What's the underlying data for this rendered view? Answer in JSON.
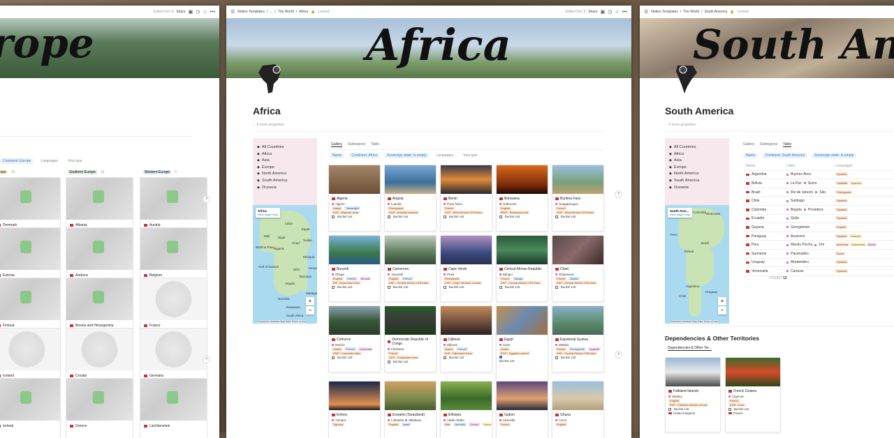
{
  "europe": {
    "edited": "Edited Dec 9",
    "share": "Share",
    "cover_title": "rope",
    "filter_continent": "Continent: Europe",
    "filter_languages": "Languages",
    "filter_visa": "Visa type",
    "groups": [
      {
        "name": "Southern Europe",
        "count": "10"
      },
      {
        "name": "Southern Europe",
        "count": "16"
      },
      {
        "name": "Western Europe",
        "count": "9"
      }
    ],
    "cards": [
      [
        "Denmark",
        "Albania",
        "Austria"
      ],
      [
        "Estonia",
        "Andorra",
        "Belgium"
      ],
      [
        "Finland",
        "Bosnia and Herzegovina",
        "France"
      ],
      [
        "Iceland",
        "Croatia",
        "Germany"
      ],
      [
        "Ireland",
        "Greece",
        "Liechtenstein"
      ]
    ]
  },
  "africa": {
    "breadcrumb": [
      "Notion Templates",
      "/",
      "...",
      "/",
      "The World",
      "/",
      "Africa"
    ],
    "locked": "Locked",
    "edited": "Edited Dec 9",
    "share": "Share",
    "cover_title": "Africa",
    "page_title": "Africa",
    "props": "6 more properties",
    "tabs": [
      "Gallery",
      "Subregions",
      "Table"
    ],
    "filters": [
      "Name",
      "Continent: Africa",
      "Sovereign state: Is empty",
      "Languages",
      "Visa type"
    ],
    "nav": [
      "All Countries",
      "Africa",
      "Asia",
      "Europe",
      "North America",
      "South America",
      "Oceania"
    ],
    "map": {
      "popup_title": "Africa",
      "popup_link": "View larger map",
      "labels": [
        "Libya",
        "Egypt",
        "Mali",
        "Niger",
        "Chad",
        "Sudan",
        "Nigeria",
        "Ethiopia",
        "DRC",
        "Angola",
        "Tanzania",
        "Namibia",
        "Botswana",
        "Madagascar",
        "South Africa",
        "Burkina Faso",
        "Gulf of Guinea",
        "Kenya"
      ],
      "footer": "Keyboard shortcuts  Map Data  Terms of Use"
    },
    "cards": [
      {
        "name": "Algeria",
        "city": "Algiers",
        "langs": [
          "Arabic",
          "Tamazight"
        ],
        "currency": "DZD - Algerian dinar",
        "bucket": "Bucket List",
        "checked": false,
        "img": "linear-gradient(180deg,#a38568,#6c4e35)"
      },
      {
        "name": "Angola",
        "city": "Luanda",
        "langs": [
          "Portuguese"
        ],
        "currency": "AOA - Angolan kwanza",
        "bucket": "Bucket List",
        "checked": false,
        "img": "linear-gradient(180deg,#7aa7d4,#3a6f9a 60%,#c9b08a)"
      },
      {
        "name": "Benin",
        "city": "Porto Novo",
        "langs": [
          "French"
        ],
        "currency": "XOF - West African CFA franc",
        "bucket": "Bucket List",
        "checked": false,
        "img": "linear-gradient(180deg,#3a3a4a,#e08a3a 50%,#2a2a30)"
      },
      {
        "name": "Botswana",
        "city": "Gaborone",
        "langs": [
          "English"
        ],
        "currency": "BWP - Botswana pula",
        "bucket": "Bucket List",
        "checked": false,
        "img": "linear-gradient(180deg,#d86a1a,#7a2a0a 70%,#1a0a05)"
      },
      {
        "name": "Burkina Faso",
        "city": "Ouagadougou",
        "langs": [
          "French"
        ],
        "currency": "XOF - West African CFA franc",
        "bucket": "Bucket List",
        "checked": false,
        "img": "linear-gradient(180deg,#9ac0e0,#7aa07a 60%,#c0a070)"
      },
      {
        "name": "Burundi",
        "city": "Gitega",
        "langs": [
          "English",
          "French",
          "Kirundi"
        ],
        "currency": "BIF - Burundian franc",
        "bucket": "Bucket List",
        "checked": false,
        "img": "linear-gradient(180deg,#7ab0d8,#3a7a4a 60%,#2a5a8a)"
      },
      {
        "name": "Cameroon",
        "city": "Yaoundé",
        "langs": [
          "English",
          "French"
        ],
        "currency": "XAF - Central African CFA franc",
        "bucket": "Bucket List",
        "checked": false,
        "img": "linear-gradient(180deg,#c0c8c0,#5a7a5a 60%,#3a4a3a)"
      },
      {
        "name": "Cape Verde",
        "city": "Praia",
        "langs": [
          "Portuguese"
        ],
        "currency": "CVE - Cape Verdean escudo",
        "bucket": "Bucket List",
        "checked": false,
        "img": "linear-gradient(180deg,#b090c0,#3a4a80 60%,#2a3050)"
      },
      {
        "name": "Central African Republic",
        "city": "Bangui",
        "langs": [
          "French",
          "Sango"
        ],
        "currency": "XAF - Central African CFA franc",
        "bucket": "Bucket List",
        "checked": false,
        "img": "linear-gradient(180deg,#2a5a3a,#4a8a5a 50%,#1a3a2a)"
      },
      {
        "name": "Chad",
        "city": "N'Djamena",
        "langs": [
          "French",
          "Arabic"
        ],
        "currency": "XAF - Central African CFA franc",
        "bucket": "Bucket List",
        "checked": false,
        "img": "linear-gradient(135deg,#5a4a4a,#8a6a6a 50%,#3a2a2a)"
      },
      {
        "name": "Comoros",
        "city": "Moroni",
        "langs": [
          "Arabic",
          "French",
          "Comorian"
        ],
        "currency": "KMF - Comorian franc",
        "bucket": "Bucket List",
        "checked": false,
        "img": "linear-gradient(180deg,#8aa0b0,#3a5a3a 50%,#2a3a2a)"
      },
      {
        "name": "Democratic Republic of Congo",
        "city": "Kinshasa",
        "langs": [
          "French"
        ],
        "currency": "CDF - Congolese franc",
        "bucket": "Bucket List",
        "checked": false,
        "img": "linear-gradient(180deg,#2a5a2a,#3a3a3a 50%,#1a3a1a)"
      },
      {
        "name": "Djibouti",
        "city": "Djibouti",
        "langs": [
          "Arabic",
          "French"
        ],
        "currency": "DJF - Djiboutian franc",
        "bucket": "Bucket List",
        "checked": false,
        "img": "linear-gradient(180deg,#c08a5a,#6a4a3a 60%,#2a2020)"
      },
      {
        "name": "Egypt",
        "city": "Cairo",
        "langs": [
          "Arabic"
        ],
        "currency": "EGP - Egyptian pound",
        "bucket": "Bucket List",
        "checked": true,
        "img": "linear-gradient(135deg,#c09050,#6a8ab0 50%,#a07040)"
      },
      {
        "name": "Equatorial Guinea",
        "city": "Malabo",
        "langs": [
          "French",
          "Portuguese",
          "Spanish"
        ],
        "currency": "XAF - Central African CFA franc",
        "bucket": "Bucket List",
        "checked": false,
        "img": "linear-gradient(180deg,#8ab0c8,#5a8a6a 60%,#4a6a5a)"
      },
      {
        "name": "Eritrea",
        "city": "Asmara",
        "langs": [
          "Tigrinya"
        ],
        "currency": "",
        "bucket": "",
        "checked": false,
        "img": "linear-gradient(180deg,#1a2a4a,#e09050 80%,#1a1a20)"
      },
      {
        "name": "Eswatini (Swaziland)",
        "city": "Lobamba",
        "city2": "Mbabane",
        "langs": [
          "English",
          "swati"
        ],
        "currency": "",
        "bucket": "",
        "checked": false,
        "img": "linear-gradient(180deg,#d0a060,#7a8a4a 60%,#4a5a2a)"
      },
      {
        "name": "Ethiopia",
        "city": "Addis Ababa",
        "langs": [
          "Afar",
          "Amharic",
          "Oromo",
          "Soma"
        ],
        "currency": "",
        "bucket": "",
        "checked": false,
        "img": "linear-gradient(180deg,#8ab050,#3a6a2a 60%,#5a8a3a)"
      },
      {
        "name": "Gabon",
        "city": "Libreville",
        "langs": [
          "French"
        ],
        "currency": "",
        "bucket": "",
        "checked": false,
        "img": "linear-gradient(180deg,#5a4a80,#e0a070 60%,#2a2a3a)"
      },
      {
        "name": "Ghana",
        "city": "Accra",
        "langs": [
          "English"
        ],
        "currency": "",
        "bucket": "",
        "checked": false,
        "img": "linear-gradient(180deg,#9ac0e0,#d8c8a8 60%,#b0a080)"
      }
    ]
  },
  "southamerica": {
    "breadcrumb": [
      "Notion Templates",
      "/",
      "The World",
      "/",
      "South America"
    ],
    "locked": "Locked",
    "cover_title": "South Am",
    "page_title": "South America",
    "props": "6 more properties",
    "tabs": [
      "Gallery",
      "Subregions",
      "Table"
    ],
    "filters": [
      "Name",
      "Continent: South America",
      "Sovereign state: Is empty"
    ],
    "nav": [
      "All Countries",
      "Africa",
      "Asia",
      "Europe",
      "North America",
      "South America",
      "Oceania"
    ],
    "map": {
      "popup_title": "South Ame...",
      "popup_link": "View larger map",
      "labels": [
        "Colombia",
        "Venezuela",
        "Peru",
        "Brazil",
        "Bolivia",
        "Argentina",
        "Chile",
        "Uruguay"
      ],
      "footer": "Keyboard shortcuts  Map Data  Terms of Use"
    },
    "table_headers": [
      "Name",
      "Cities",
      "Languages"
    ],
    "rows": [
      {
        "name": "Argentina",
        "city": "Buenos Aires",
        "langs": [
          "Spanish"
        ]
      },
      {
        "name": "Bolivia",
        "city": "La Paz",
        "city2": "Sucre",
        "langs": [
          "Castilian",
          "Spanish"
        ]
      },
      {
        "name": "Brazil",
        "city": "Rio de Janeiro",
        "city2": "São",
        "langs": [
          "Portuguese"
        ]
      },
      {
        "name": "Chile",
        "city": "Santiago",
        "langs": [
          "Spanish"
        ]
      },
      {
        "name": "Colombia",
        "city": "Bogota",
        "city2": "Providenc",
        "langs": [
          "Spanish"
        ]
      },
      {
        "name": "Ecuador",
        "city": "Quito",
        "langs": [
          "Spanish"
        ]
      },
      {
        "name": "Guyana",
        "city": "Georgetown",
        "langs": [
          "English"
        ]
      },
      {
        "name": "Paraguay",
        "city": "Asuncion",
        "langs": [
          "Spanish",
          "Guarani"
        ]
      },
      {
        "name": "Peru",
        "city": "Machu Picchu",
        "city2": "Lim",
        "langs": [
          "Quechua",
          "Achaninka",
          "Ayma"
        ]
      },
      {
        "name": "Suriname",
        "city": "Paramaribo",
        "langs": [
          "Dutch"
        ]
      },
      {
        "name": "Uruguay",
        "city": "Montevideo",
        "langs": [
          "Spanish"
        ]
      },
      {
        "name": "Venezuela",
        "city": "Caracas",
        "langs": [
          "Spanish"
        ]
      }
    ],
    "count_label": "COUNT",
    "count": "12",
    "dep_title": "Dependencies & Other Territories",
    "dep_tab": "Dependencies & Other Ter...",
    "dep_cards": [
      {
        "name": "Falkland Islands",
        "city": "Stanley",
        "langs": [
          "English"
        ],
        "currency": "FKP - Falkland Islands' pound",
        "bucket": "Bucket List",
        "sov": "United Kingdom"
      },
      {
        "name": "French Guiana",
        "city": "Cayenne",
        "langs": [
          "French"
        ],
        "currency": "EUR - Euro",
        "bucket": "Bucket List",
        "sov": "France"
      }
    ]
  },
  "colors": {
    "accent": "#2a75d5",
    "sidebar": "#f6e8ec",
    "map_water": "#aadaf0"
  }
}
